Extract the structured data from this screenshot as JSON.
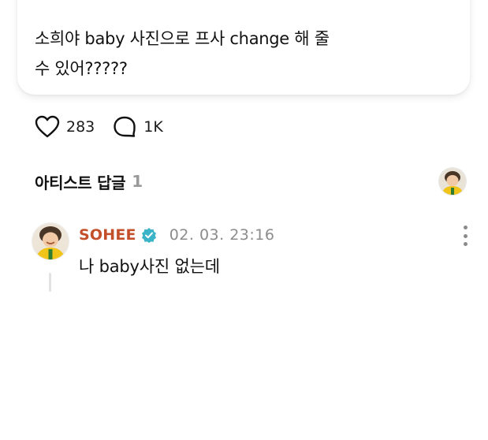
{
  "post": {
    "text_line1": "소희야 baby 사진으로 프사 change 해 줄",
    "text_line2": "수 있어?????"
  },
  "actions": {
    "like_icon": "heart-outline-icon",
    "like_count": "283",
    "comment_icon": "speech-bubble-icon",
    "comment_count": "1K"
  },
  "artist_replies": {
    "title": "아티스트 답글",
    "count": "1",
    "header_avatar_icon": "artist-avatar"
  },
  "comment": {
    "author": "SOHEE",
    "verified_icon": "verified-badge-icon",
    "timestamp": "02. 03. 23:16",
    "body": "나 baby사진 없는데",
    "more_icon": "more-vertical-icon"
  },
  "colors": {
    "author_name": "#c4502b",
    "verified_badge": "#3cb4c8",
    "muted_text": "#8c8c8c"
  }
}
